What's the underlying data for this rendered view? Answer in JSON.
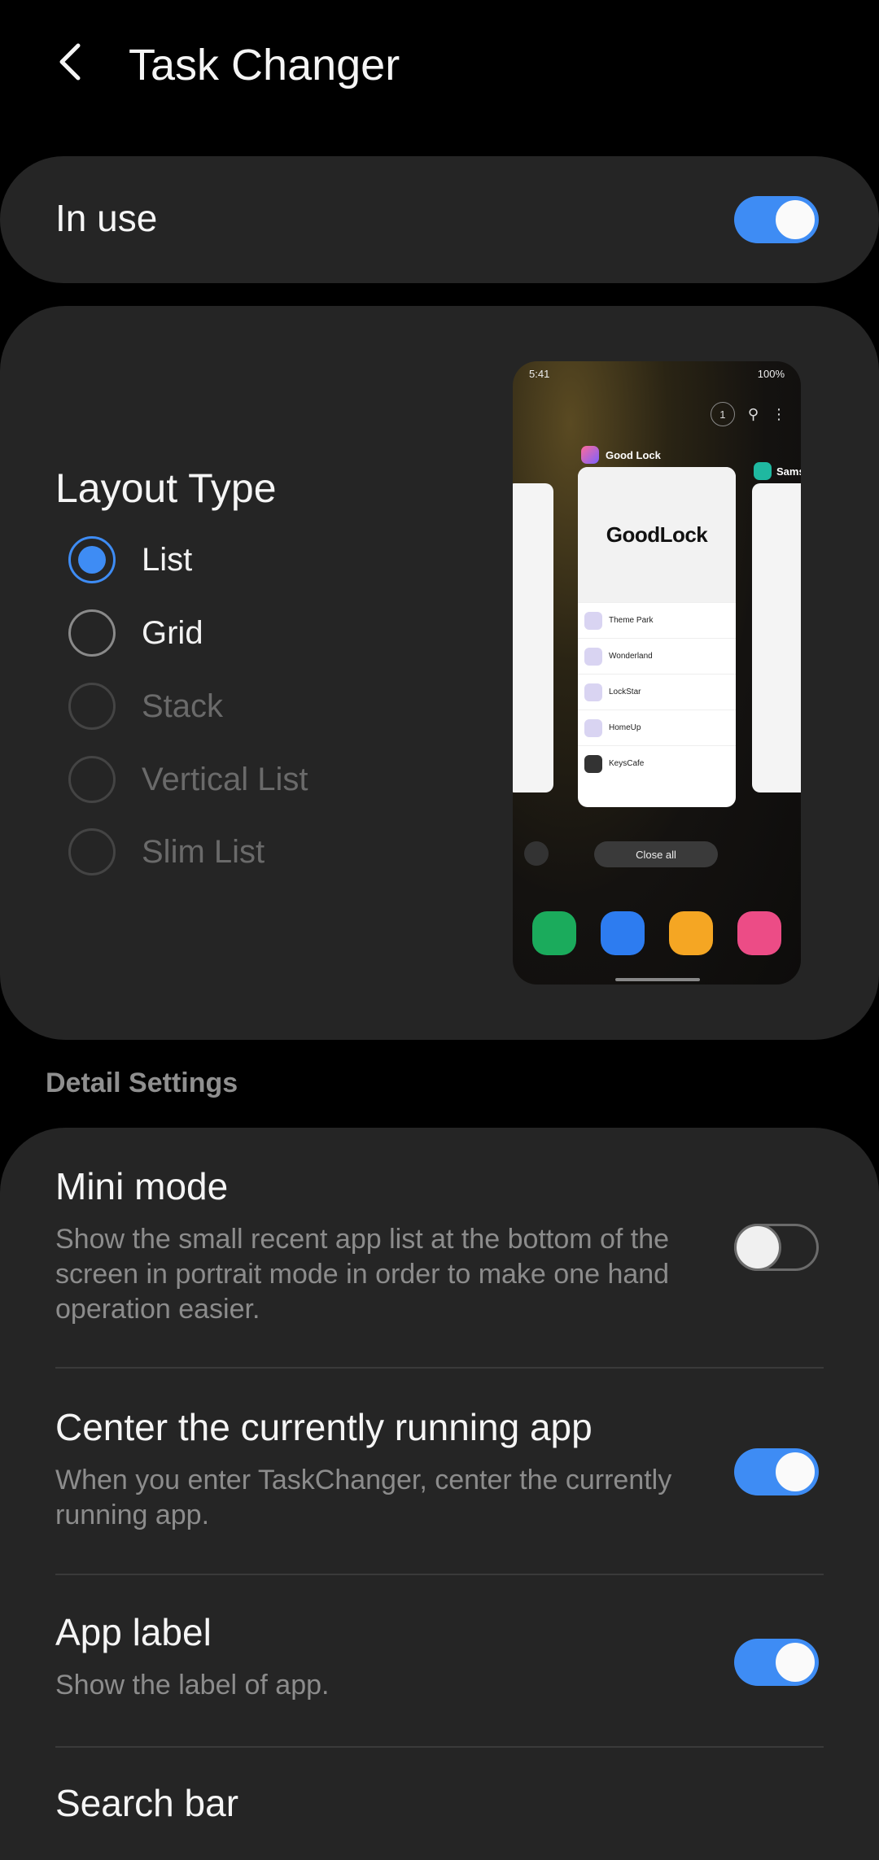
{
  "header": {
    "title": "Task Changer"
  },
  "in_use": {
    "label": "In use",
    "enabled": true
  },
  "layout": {
    "title": "Layout Type",
    "options": [
      {
        "label": "List",
        "selected": true,
        "disabled": false
      },
      {
        "label": "Grid",
        "selected": false,
        "disabled": false
      },
      {
        "label": "Stack",
        "selected": false,
        "disabled": true
      },
      {
        "label": "Vertical List",
        "selected": false,
        "disabled": true
      },
      {
        "label": "Slim List",
        "selected": false,
        "disabled": true
      }
    ]
  },
  "preview": {
    "time": "5:41",
    "status": "100%",
    "recents_count": "1",
    "main_app": "Good Lock",
    "side_app": "Sams",
    "card_title": "GoodLock",
    "list_items": [
      "Theme Park",
      "Wonderland",
      "LockStar",
      "HomeUp",
      "KeysCafe"
    ],
    "close_all": "Close all"
  },
  "detail_section": {
    "title": "Detail Settings"
  },
  "settings": {
    "mini_mode": {
      "title": "Mini mode",
      "desc": "Show the small recent app list at the bottom of the screen in portrait mode in order to make one hand operation easier.",
      "enabled": false
    },
    "center_app": {
      "title": "Center the currently running app",
      "desc": "When you enter TaskChanger, center the currently running app.",
      "enabled": true
    },
    "app_label": {
      "title": "App label",
      "desc": "Show the label of app.",
      "enabled": true
    },
    "search_bar": {
      "title": "Search bar"
    }
  },
  "colors": {
    "accent": "#3e8cf4",
    "card": "#252525",
    "background": "#000000"
  }
}
